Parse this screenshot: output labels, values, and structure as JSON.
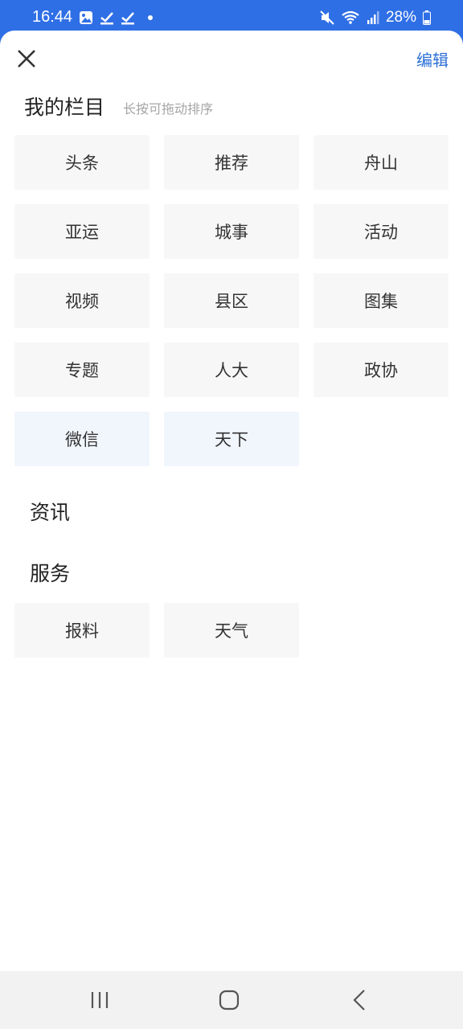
{
  "status_bar": {
    "time": "16:44",
    "battery": "28%",
    "left_icons": [
      "gallery-icon",
      "check-icon",
      "check-icon",
      "dot-icon"
    ],
    "right_icons": [
      "mute-icon",
      "wifi-icon",
      "signal-icon",
      "battery-icon"
    ]
  },
  "header": {
    "edit_label": "编辑"
  },
  "my_channels": {
    "title": "我的栏目",
    "hint": "长按可拖动排序",
    "items": [
      {
        "label": "头条"
      },
      {
        "label": "推荐"
      },
      {
        "label": "舟山"
      },
      {
        "label": "亚运"
      },
      {
        "label": "城事"
      },
      {
        "label": "活动"
      },
      {
        "label": "视频"
      },
      {
        "label": "县区"
      },
      {
        "label": "图集"
      },
      {
        "label": "专题"
      },
      {
        "label": "人大"
      },
      {
        "label": "政协"
      },
      {
        "label": "微信"
      },
      {
        "label": "天下"
      }
    ]
  },
  "news_section": {
    "title": "资讯"
  },
  "service_section": {
    "title": "服务",
    "items": [
      {
        "label": "报料"
      },
      {
        "label": "天气"
      }
    ]
  }
}
